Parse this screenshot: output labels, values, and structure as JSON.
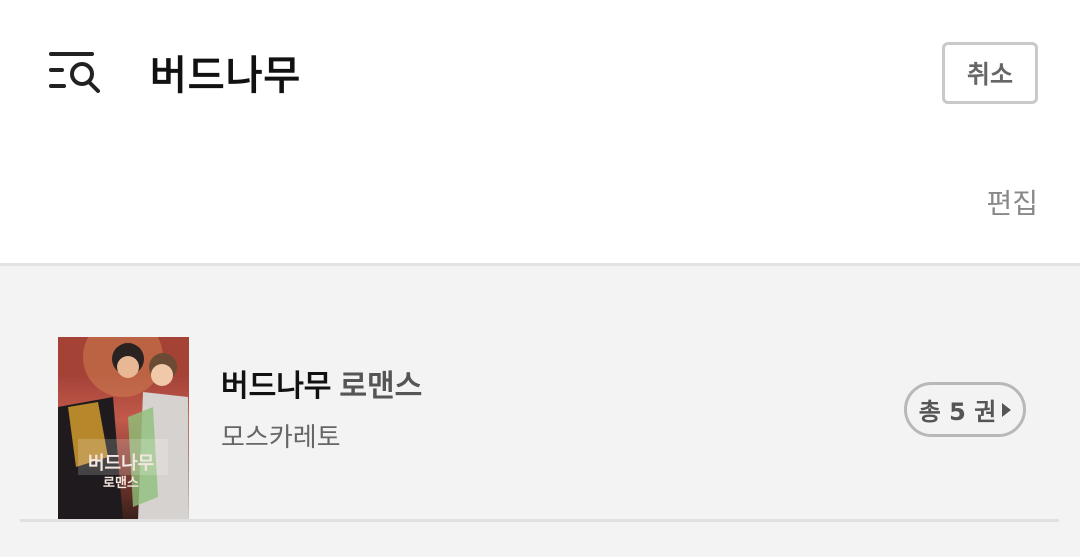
{
  "header": {
    "filter_search_icon": "list-search-icon",
    "search_value": "버드나무",
    "cancel_label": "취소",
    "edit_label": "편집"
  },
  "results": [
    {
      "title": "버드나무",
      "genre": "로맨스",
      "author": "모스카레토",
      "count_label": "총 5 권",
      "arrow_icon": "play-triangle-icon",
      "cover_text": "버드나무 로맨스"
    }
  ],
  "colors": {
    "background": "#ffffff",
    "results_background": "#f3f3f3",
    "border": "#c9c9c9",
    "muted_text": "#888888"
  }
}
